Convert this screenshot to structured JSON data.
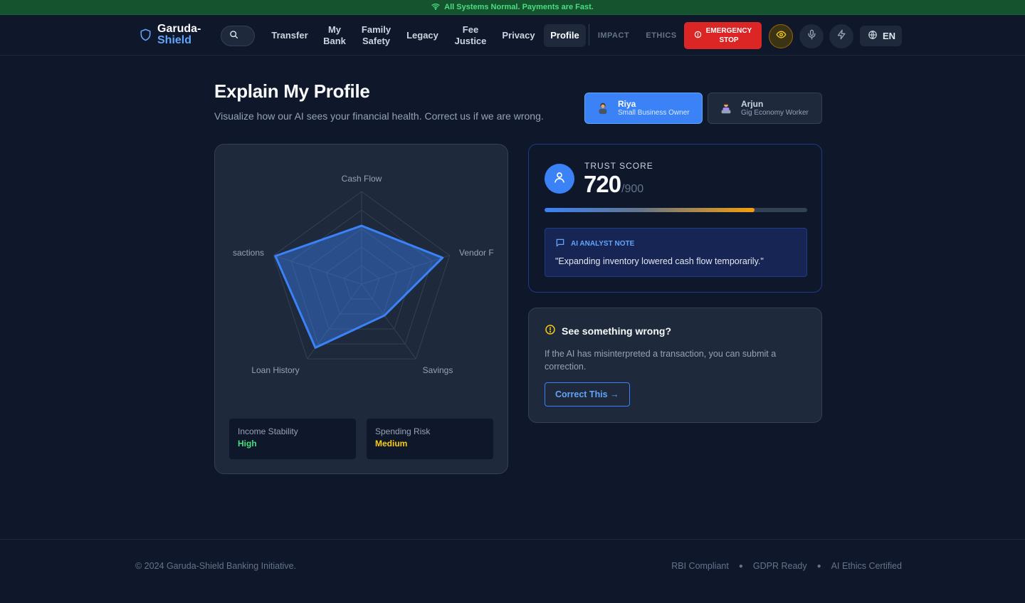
{
  "status_bar": {
    "text": "All Systems Normal. Payments are Fast.",
    "icon": "wifi-icon",
    "color": "#4ade80"
  },
  "brand": {
    "line1": "Garuda-",
    "line2": "Shield",
    "icon": "shield-icon",
    "accent": "#60a5fa"
  },
  "nav": {
    "search_icon": "search-icon",
    "items": [
      {
        "label": "Transfer"
      },
      {
        "label_line1": "My",
        "label_line2": "Bank"
      },
      {
        "label_line1": "Family",
        "label_line2": "Safety"
      },
      {
        "label": "Legacy"
      },
      {
        "label_line1": "Fee",
        "label_line2": "Justice"
      },
      {
        "label": "Privacy"
      },
      {
        "label": "Profile",
        "active": true
      },
      {
        "label": "IMPACT"
      },
      {
        "label": "ETHICS"
      }
    ],
    "emergency": {
      "line1": "EMERGENCY",
      "line2": "STOP",
      "color": "#dc2626"
    },
    "icons": [
      "eye-icon",
      "microphone-icon",
      "lightning-icon"
    ],
    "language": "EN"
  },
  "page": {
    "title": "Explain My Profile",
    "subtitle": "Visualize how our AI sees your financial health. Correct us if we are wrong."
  },
  "personas": [
    {
      "name": "Riya",
      "role": "Small Business Owner",
      "active": true
    },
    {
      "name": "Arjun",
      "role": "Gig Economy Worker",
      "active": false
    }
  ],
  "radar": {
    "axes": [
      "Cash Flow",
      "Vendor Payments",
      "Savings",
      "Loan History",
      "Transactions"
    ],
    "axis_labels_visible": [
      "Cash Flow",
      "Vendor F",
      "Savings",
      "Loan History",
      "sactions"
    ],
    "values": [
      0.63,
      0.92,
      0.42,
      0.85,
      0.98
    ],
    "color": "#3b82f6"
  },
  "metrics": [
    {
      "label": "Income Stability",
      "value": "High",
      "color": "#4ade80"
    },
    {
      "label": "Spending Risk",
      "value": "Medium",
      "color": "#facc15"
    }
  ],
  "trust": {
    "label": "TRUST SCORE",
    "score": "720",
    "max": "/900",
    "progress": 0.8,
    "note_title": "AI ANALYST NOTE",
    "note_text": "\"Expanding inventory lowered cash flow temporarily.\""
  },
  "wrong": {
    "title": "See something wrong?",
    "text": "If the AI has misinterpreted a transaction, you can submit a correction.",
    "button": "Correct This →"
  },
  "footer": {
    "copyright": "© 2024 Garuda-Shield Banking Initiative.",
    "links": [
      "RBI Compliant",
      "GDPR Ready",
      "AI Ethics Certified"
    ]
  }
}
